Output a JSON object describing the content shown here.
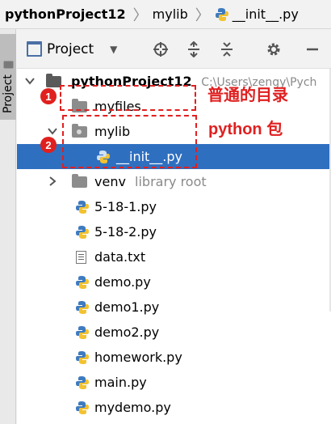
{
  "breadcrumb": {
    "project": "pythonProject12",
    "folder": "mylib",
    "file": "__init__.py"
  },
  "side_tab": {
    "label": "Project"
  },
  "toolbar": {
    "view_label": "Project"
  },
  "icons": {
    "view_dropdown": "chevron-down-icon",
    "locate": "crosshair-icon",
    "expand": "expand-all-icon",
    "collapse": "collapse-all-icon",
    "settings": "gear-icon",
    "hide": "minimize-icon"
  },
  "tree": {
    "root": {
      "name": "pythonProject12",
      "path": "C:\\Users\\zengy\\Pych"
    },
    "myfiles": {
      "name": "myfiles"
    },
    "mylib": {
      "name": "mylib"
    },
    "init": {
      "name": "__init__.py"
    },
    "venv": {
      "name": "venv",
      "hint": "library root"
    },
    "files": [
      {
        "name": "5-18-1.py",
        "type": "python"
      },
      {
        "name": "5-18-2.py",
        "type": "python"
      },
      {
        "name": "data.txt",
        "type": "text"
      },
      {
        "name": "demo.py",
        "type": "python"
      },
      {
        "name": "demo1.py",
        "type": "python"
      },
      {
        "name": "demo2.py",
        "type": "python"
      },
      {
        "name": "homework.py",
        "type": "python"
      },
      {
        "name": "main.py",
        "type": "python"
      },
      {
        "name": "mydemo.py",
        "type": "python"
      }
    ]
  },
  "annotations": {
    "badge1": "1",
    "badge2": "2",
    "label1": "普通的目录",
    "label2": "python 包"
  },
  "colors": {
    "selection": "#2f6fc0",
    "annotation": "#e02020",
    "python_blue": "#3e7bbf",
    "python_yellow": "#f2c230"
  }
}
